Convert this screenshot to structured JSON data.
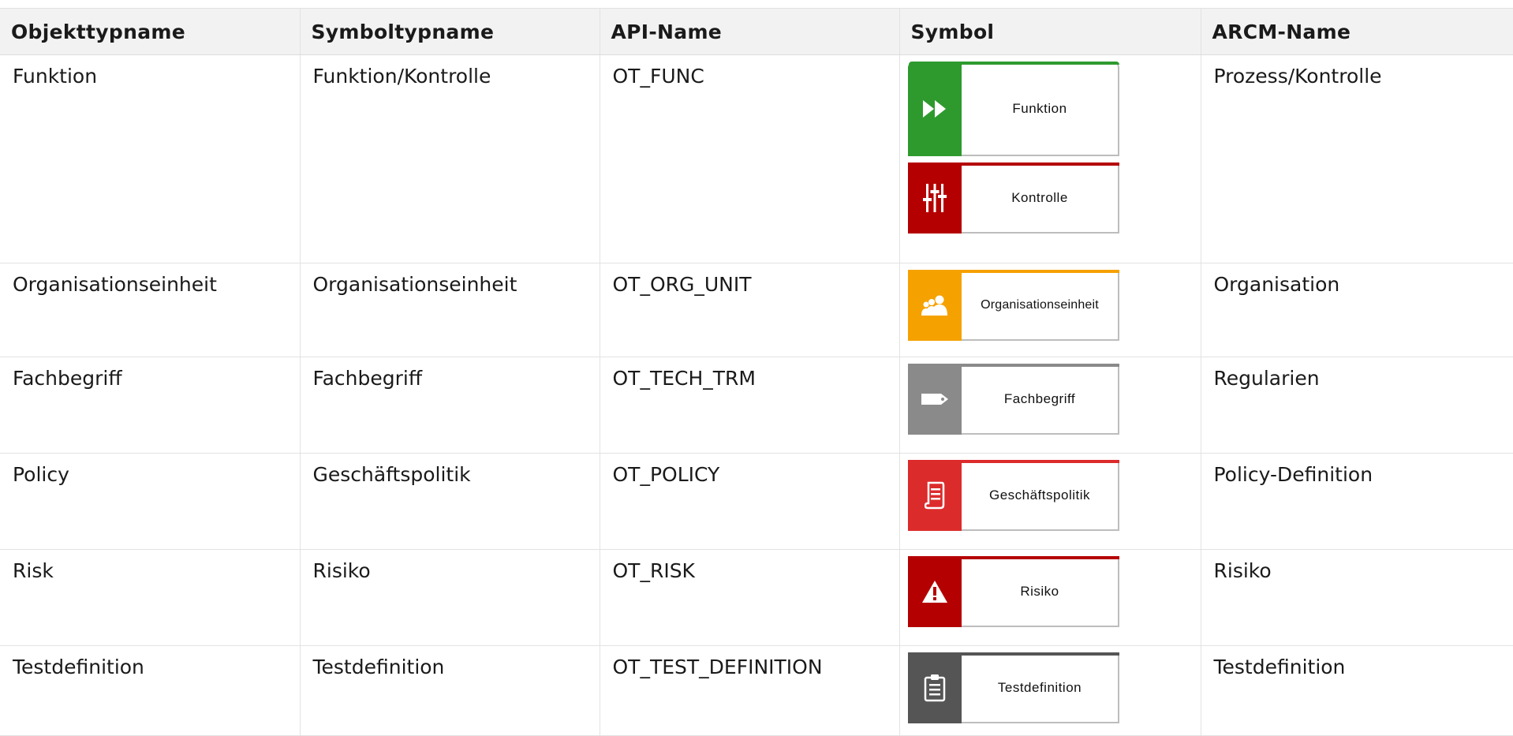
{
  "table": {
    "headers": [
      "Objekttypname",
      "Symboltypname",
      "API-Name",
      "Symbol",
      "ARCM-Name"
    ],
    "rows": [
      {
        "object_type": "Funktion",
        "symbol_type": "Funktion/Kontrolle",
        "api_name": "OT_FUNC",
        "symbols": [
          {
            "label": "Funktion",
            "icon": "fast-forward-icon",
            "color": "#2e9a2e"
          },
          {
            "label": "Kontrolle",
            "icon": "sliders-icon",
            "color": "#b40000"
          }
        ],
        "arcm_name": "Prozess/Kontrolle"
      },
      {
        "object_type": "Organisationseinheit",
        "symbol_type": "Organisationseinheit",
        "api_name": "OT_ORG_UNIT",
        "symbols": [
          {
            "label": "Organisationseinheit",
            "icon": "people-group-icon",
            "color": "#f5a100"
          }
        ],
        "arcm_name": "Organisation"
      },
      {
        "object_type": "Fachbegriff",
        "symbol_type": "Fachbegriff",
        "api_name": "OT_TECH_TRM",
        "symbols": [
          {
            "label": "Fachbegriff",
            "icon": "tag-icon",
            "color": "#8a8a8a"
          }
        ],
        "arcm_name": "Regularien"
      },
      {
        "object_type": "Policy",
        "symbol_type": "Geschäftspolitik",
        "api_name": "OT_POLICY",
        "symbols": [
          {
            "label": "Geschäftspolitik",
            "icon": "scroll-document-icon",
            "color": "#dc2b2b"
          }
        ],
        "arcm_name": "Policy-Definition"
      },
      {
        "object_type": "Risk",
        "symbol_type": "Risiko",
        "api_name": "OT_RISK",
        "symbols": [
          {
            "label": "Risiko",
            "icon": "warning-triangle-icon",
            "color": "#b40000"
          }
        ],
        "arcm_name": "Risiko"
      },
      {
        "object_type": "Testdefinition",
        "symbol_type": "Testdefinition",
        "api_name": "OT_TEST_DEFINITION",
        "symbols": [
          {
            "label": "Testdefinition",
            "icon": "clipboard-icon",
            "color": "#555555"
          }
        ],
        "arcm_name": "Testdefinition"
      }
    ]
  }
}
